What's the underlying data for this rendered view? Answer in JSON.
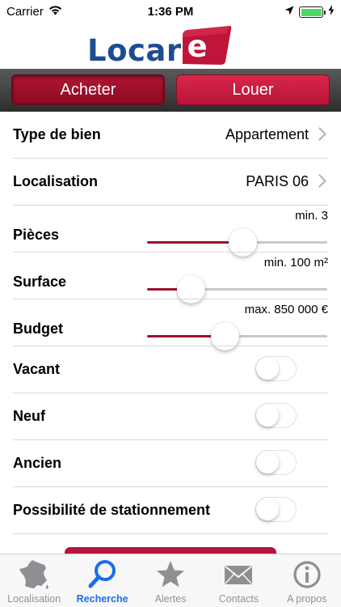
{
  "status_bar": {
    "carrier": "Carrier",
    "time": "1:36 PM",
    "wifi_icon": "wifi-icon",
    "location_icon": "location-arrow-icon",
    "battery_icon": "battery-icon",
    "battery_level": 1.0,
    "charging_icon": "charging-bolt-icon"
  },
  "brand": {
    "logo_text_main": "Locar",
    "logo_text_accent": "e",
    "colors": {
      "blue": "#1e4d8f",
      "red": "#c0143a"
    }
  },
  "segments": {
    "buy_label": "Acheter",
    "rent_label": "Louer",
    "selected": "Acheter"
  },
  "form": {
    "property_type": {
      "label": "Type de bien",
      "value": "Appartement"
    },
    "location": {
      "label": "Localisation",
      "value": "PARIS 06"
    },
    "rooms": {
      "label": "Pièces",
      "value_text": "min. 3",
      "fraction": 0.53
    },
    "surface": {
      "label": "Surface",
      "value_text": "min. 100 m²",
      "fraction": 0.24
    },
    "budget": {
      "label": "Budget",
      "value_text": "max. 850 000 €",
      "fraction": 0.43
    },
    "vacant": {
      "label": "Vacant",
      "on": false
    },
    "new": {
      "label": "Neuf",
      "on": false
    },
    "old": {
      "label": "Ancien",
      "on": false
    },
    "parking": {
      "label": "Possibilité de stationnement",
      "on": false
    }
  },
  "tab_bar": {
    "active": "Recherche",
    "tabs": [
      {
        "label": "Localisation",
        "icon": "france-map-icon"
      },
      {
        "label": "Recherche",
        "icon": "magnifier-icon"
      },
      {
        "label": "Alertes",
        "icon": "star-icon"
      },
      {
        "label": "Contacts",
        "icon": "envelope-icon"
      },
      {
        "label": "A propos",
        "icon": "info-icon"
      }
    ]
  }
}
